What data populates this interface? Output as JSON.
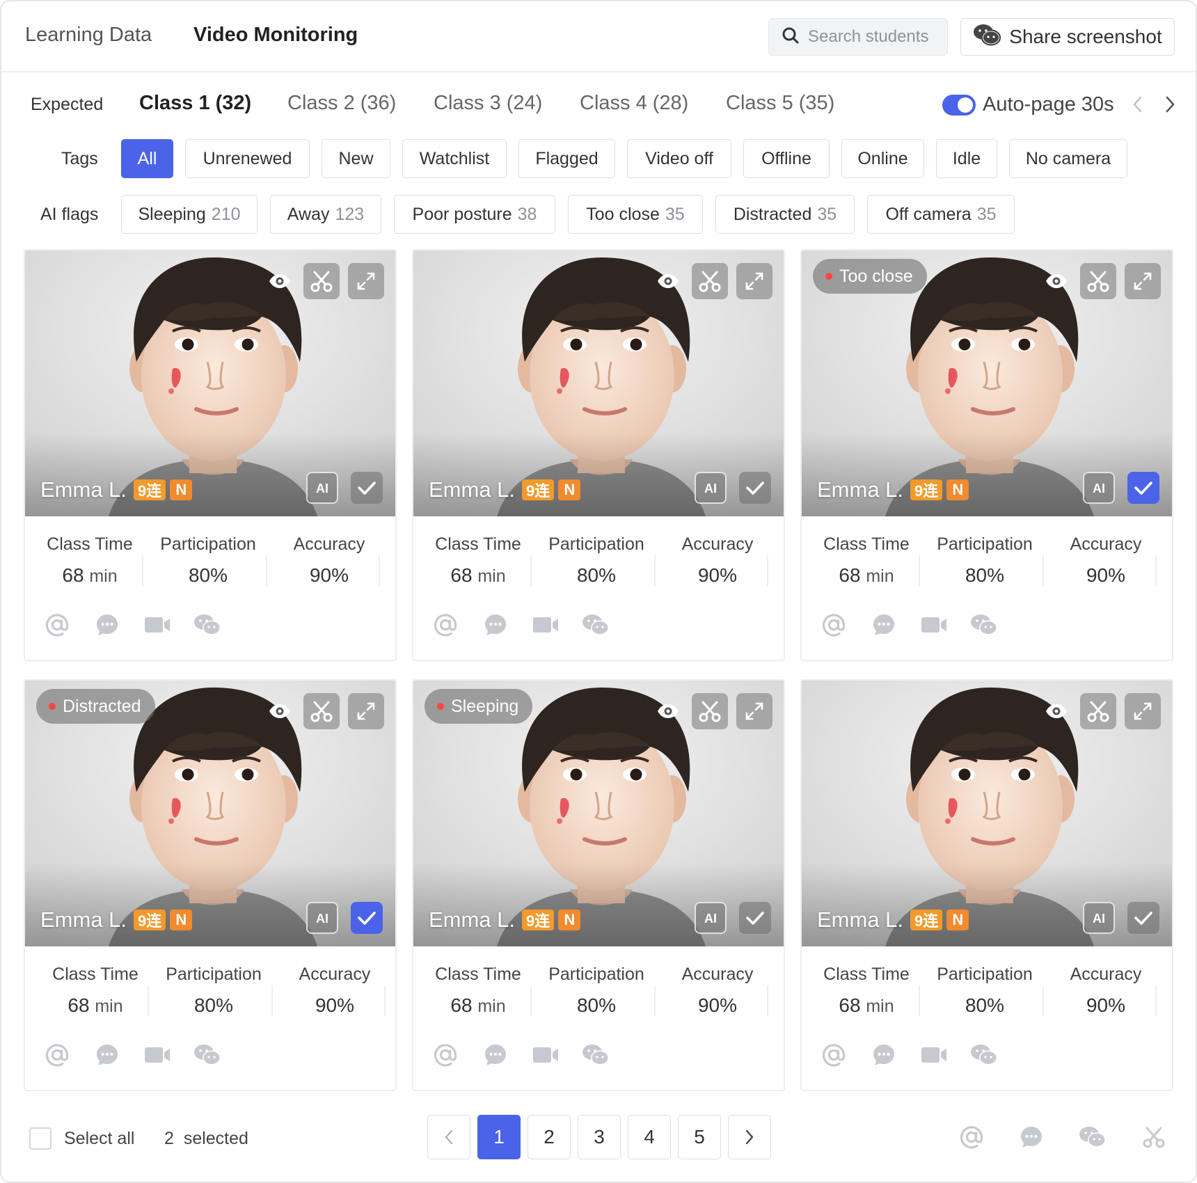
{
  "header": {
    "nav_tabs": [
      {
        "label": "Learning Data",
        "active": false
      },
      {
        "label": "Video Monitoring",
        "active": true
      }
    ],
    "search_placeholder": "Search students",
    "share_label": "Share screenshot"
  },
  "classes": {
    "label": "Expected",
    "tabs": [
      {
        "label": "Class 1 (32)",
        "active": true
      },
      {
        "label": "Class 2 (36)",
        "active": false
      },
      {
        "label": "Class 3 (24)",
        "active": false
      },
      {
        "label": "Class 4 (28)",
        "active": false
      },
      {
        "label": "Class 5 (35)",
        "active": false
      }
    ],
    "auto_page_label": "Auto-page 30s",
    "auto_page_on": true
  },
  "tags": {
    "label": "Tags",
    "items": [
      "All",
      "Unrenewed",
      "New",
      "Watchlist",
      "Flagged",
      "Video off",
      "Offline",
      "Online",
      "Idle",
      "No camera"
    ],
    "active_index": 0
  },
  "ai_flags": {
    "label": "AI flags",
    "items": [
      {
        "label": "Sleeping",
        "count": "210"
      },
      {
        "label": "Away",
        "count": "123"
      },
      {
        "label": "Poor posture",
        "count": "38"
      },
      {
        "label": "Too close",
        "count": "35"
      },
      {
        "label": "Distracted",
        "count": "35"
      },
      {
        "label": "Off camera",
        "count": "35"
      }
    ]
  },
  "stat_labels": {
    "class_time": "Class Time",
    "participation": "Participation",
    "accuracy": "Accuracy"
  },
  "cards": [
    {
      "name": "Emma L.",
      "streak": "9连",
      "new_badge": "N",
      "flag": "",
      "selected": false,
      "class_time": "68",
      "unit": "min",
      "participation": "80%",
      "accuracy": "90%"
    },
    {
      "name": "Emma L.",
      "streak": "9连",
      "new_badge": "N",
      "flag": "",
      "selected": false,
      "class_time": "68",
      "unit": "min",
      "participation": "80%",
      "accuracy": "90%"
    },
    {
      "name": "Emma L.",
      "streak": "9连",
      "new_badge": "N",
      "flag": "Too close",
      "selected": true,
      "class_time": "68",
      "unit": "min",
      "participation": "80%",
      "accuracy": "90%"
    },
    {
      "name": "Emma L.",
      "streak": "9连",
      "new_badge": "N",
      "flag": "Distracted",
      "selected": true,
      "class_time": "68",
      "unit": "min",
      "participation": "80%",
      "accuracy": "90%"
    },
    {
      "name": "Emma L.",
      "streak": "9连",
      "new_badge": "N",
      "flag": "Sleeping",
      "selected": false,
      "class_time": "68",
      "unit": "min",
      "participation": "80%",
      "accuracy": "90%"
    },
    {
      "name": "Emma L.",
      "streak": "9连",
      "new_badge": "N",
      "flag": "",
      "selected": false,
      "class_time": "68",
      "unit": "min",
      "participation": "80%",
      "accuracy": "90%"
    }
  ],
  "footer": {
    "select_all_label": "Select all",
    "selected_count": "2",
    "selected_suffix": "selected",
    "pages": [
      "1",
      "2",
      "3",
      "4",
      "5"
    ],
    "current_page": "1"
  },
  "colors": {
    "accent": "#4a63e8",
    "badge": "#f39a2b",
    "flag_dot": "#ff4444",
    "icon_gray": "#c6c9cf"
  },
  "icons": [
    "search-icon",
    "wechat-icon",
    "eye-icon",
    "scissors-icon",
    "expand-icon",
    "ai-icon",
    "check-icon",
    "at-icon",
    "chat-icon",
    "video-icon",
    "chevron-left-icon",
    "chevron-right-icon"
  ]
}
